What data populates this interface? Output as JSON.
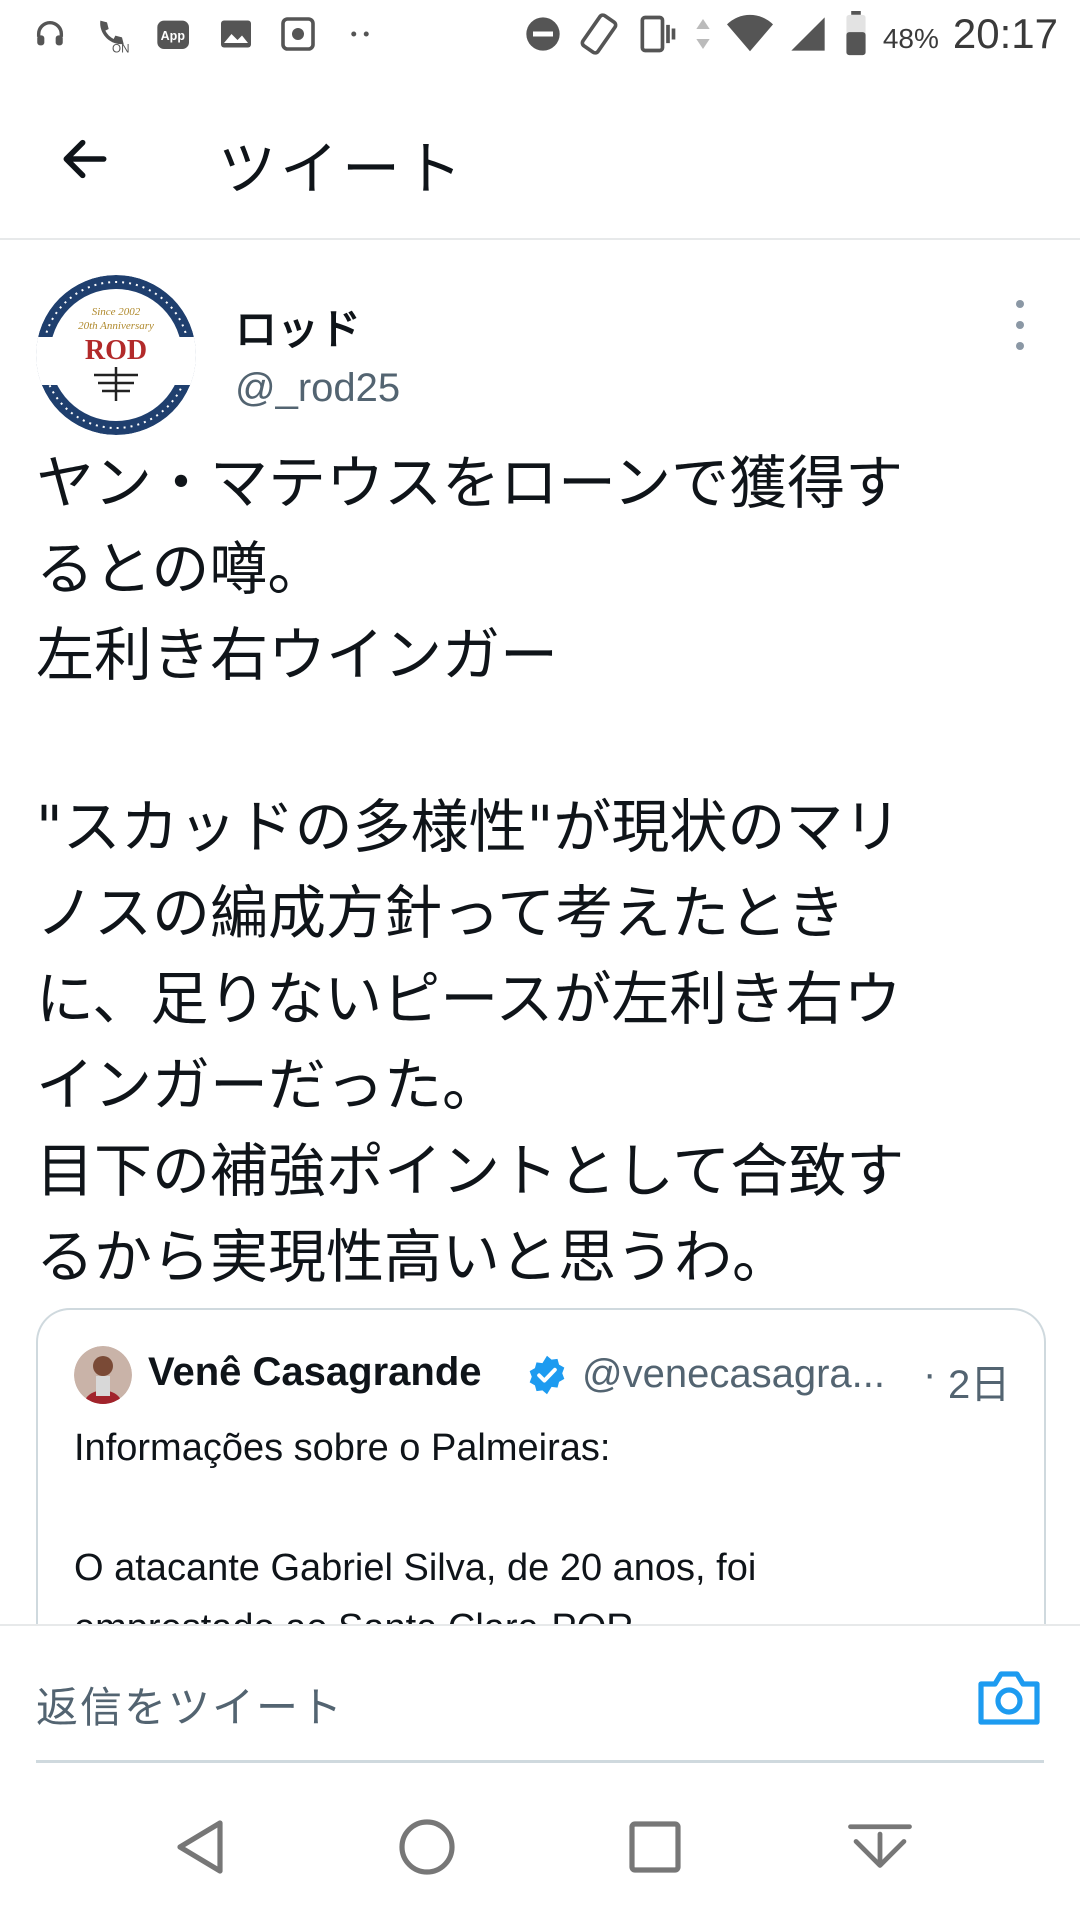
{
  "status_bar": {
    "time": "20:17",
    "battery": "48%",
    "icons": [
      "headset-icon",
      "call-on-icon",
      "app-icon",
      "image-icon",
      "settings-box-icon",
      "more-dots-icon",
      "do-not-disturb-icon",
      "rotate-icon",
      "vibrate-icon",
      "data-arrows-icon",
      "wifi-icon",
      "signal-icon",
      "battery-icon"
    ],
    "app_label": "App",
    "on_label": "ON"
  },
  "header": {
    "title": "ツイート",
    "back_icon": "back-arrow-icon"
  },
  "tweet": {
    "author_name": "ロッド",
    "author_handle": "@_rod25",
    "avatar": {
      "line1": "Since 2002",
      "line2": "20th Anniversary",
      "wordmark": "ROD"
    },
    "lines": [
      "ヤン・マテウスをローンで獲得す",
      "るとの噂。",
      "左利き右ウインガー",
      "",
      "\"スカッドの多様性\"が現状のマリ",
      "ノスの編成方針って考えたとき",
      "に、足りないピースが左利き右ウ",
      "インガーだった。",
      "目下の補強ポイントとして合致す",
      "るから実現性高いと思うわ。"
    ]
  },
  "quoted_tweet": {
    "name": "Venê Casagrande",
    "handle": "@venecasagra...",
    "separator": "·",
    "time": "2日",
    "lines": [
      "Informações sobre o Palmeiras:",
      "",
      "O atacante Gabriel Silva, de 20 anos, foi",
      "emprestado ao Santa Clara-POR."
    ]
  },
  "reply": {
    "placeholder": "返信をツイート",
    "camera_icon": "camera-icon"
  },
  "colors": {
    "accent": "#1d9bf0",
    "text": "#0f1419",
    "secondary": "#536471",
    "border": "#cfd9de"
  }
}
